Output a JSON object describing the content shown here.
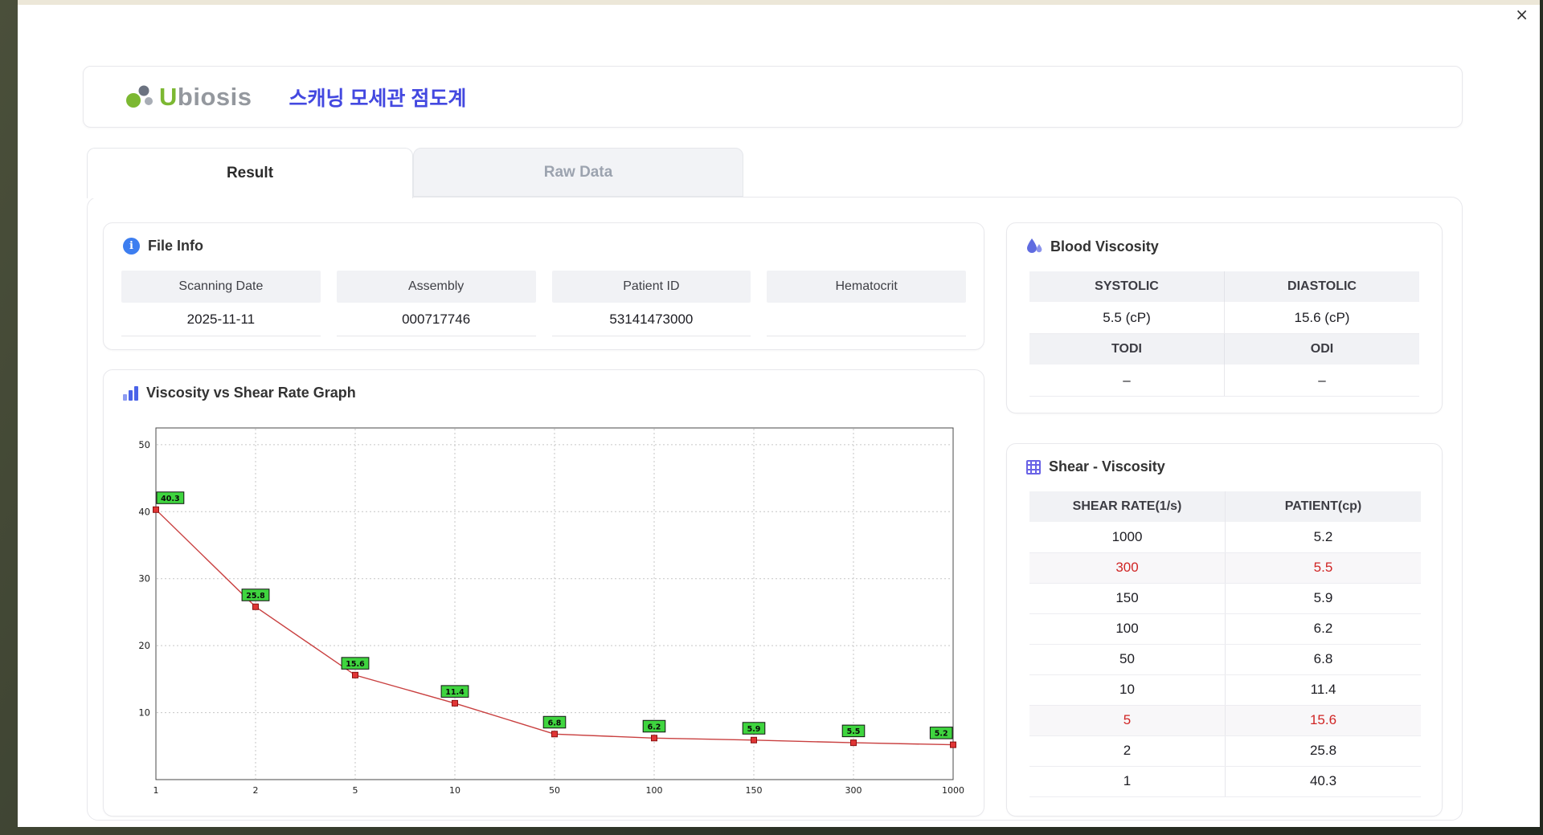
{
  "window": {
    "close_label": "×"
  },
  "icons": {
    "info_glyph": "i"
  },
  "header": {
    "logo_part1": "U",
    "logo_part2": "biosis",
    "title": "스캐닝 모세관 점도계"
  },
  "tabs": [
    {
      "label": "Result",
      "active": true
    },
    {
      "label": "Raw Data",
      "active": false
    }
  ],
  "file_info": {
    "title": "File Info",
    "fields": [
      {
        "label": "Scanning Date",
        "value": "2025-11-11"
      },
      {
        "label": "Assembly",
        "value": "000717746"
      },
      {
        "label": "Patient ID",
        "value": "53141473000"
      },
      {
        "label": "Hematocrit",
        "value": ""
      }
    ]
  },
  "blood_viscosity": {
    "title": "Blood Viscosity",
    "sections": [
      {
        "headers": [
          "SYSTOLIC",
          "DIASTOLIC"
        ],
        "values": [
          "5.5 (cP)",
          "15.6 (cP)"
        ]
      },
      {
        "headers": [
          "TODI",
          "ODI"
        ],
        "values": [
          "–",
          "–"
        ]
      }
    ]
  },
  "shear_viscosity": {
    "title": "Shear - Viscosity",
    "columns": [
      "SHEAR RATE(1/s)",
      "PATIENT(cp)"
    ],
    "rows": [
      {
        "shear": "1000",
        "patient": "5.2",
        "highlight": false
      },
      {
        "shear": "300",
        "patient": "5.5",
        "highlight": true
      },
      {
        "shear": "150",
        "patient": "5.9",
        "highlight": false
      },
      {
        "shear": "100",
        "patient": "6.2",
        "highlight": false
      },
      {
        "shear": "50",
        "patient": "6.8",
        "highlight": false
      },
      {
        "shear": "10",
        "patient": "11.4",
        "highlight": false
      },
      {
        "shear": "5",
        "patient": "15.6",
        "highlight": true
      },
      {
        "shear": "2",
        "patient": "25.8",
        "highlight": false
      },
      {
        "shear": "1",
        "patient": "40.3",
        "highlight": false
      }
    ]
  },
  "chart_data": {
    "type": "line",
    "title": "Viscosity vs Shear Rate Graph",
    "x_categories": [
      "1",
      "2",
      "5",
      "10",
      "50",
      "100",
      "150",
      "300",
      "1000"
    ],
    "values": [
      40.3,
      25.8,
      15.6,
      11.4,
      6.8,
      6.2,
      5.9,
      5.5,
      5.2
    ],
    "xlabel": "",
    "ylabel": "",
    "y_ticks": [
      10,
      20,
      30,
      40,
      50
    ],
    "ylim": [
      0,
      52.5
    ],
    "x_scale": "category",
    "grid": "dashed",
    "legend": "none",
    "line_color": "#c94040",
    "marker_color": "#e03535",
    "marker_border": "#8a1010",
    "label_bg": "#3fd53f",
    "label_border": "#111111"
  }
}
